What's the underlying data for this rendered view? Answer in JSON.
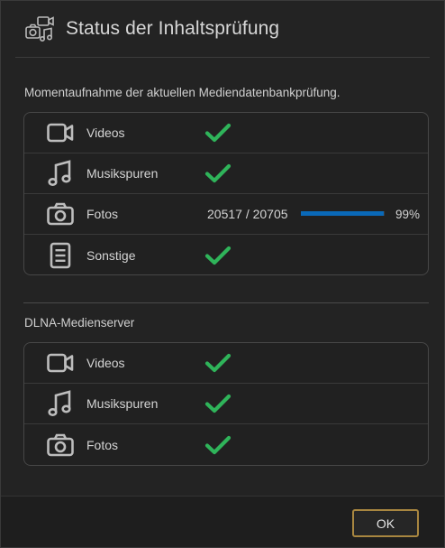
{
  "dialog": {
    "title": "Status der Inhaltsprüfung",
    "header_icon": "media-collection-icon"
  },
  "scan": {
    "description": "Momentaufnahme der aktuellen Mediendatenbankprüfung.",
    "items": [
      {
        "label": "Videos",
        "icon": "video-camera-icon",
        "status": "done"
      },
      {
        "label": "Musikspuren",
        "icon": "music-notes-icon",
        "status": "done"
      },
      {
        "label": "Fotos",
        "icon": "camera-icon",
        "status": "in-progress",
        "count": "20517 / 20705",
        "percent_text": "99%",
        "progress_fraction": 0.99
      },
      {
        "label": "Sonstige",
        "icon": "document-icon",
        "status": "done"
      }
    ]
  },
  "dlna": {
    "label": "DLNA-Medienserver",
    "items": [
      {
        "label": "Videos",
        "icon": "video-camera-icon",
        "status": "done"
      },
      {
        "label": "Musikspuren",
        "icon": "music-notes-icon",
        "status": "done"
      },
      {
        "label": "Fotos",
        "icon": "camera-icon",
        "status": "done"
      }
    ]
  },
  "footer": {
    "ok_label": "OK"
  },
  "colors": {
    "check": "#2fb45a",
    "progress": "#0a69b8",
    "button_border": "#a88640",
    "icon": "#bdbdbd"
  }
}
